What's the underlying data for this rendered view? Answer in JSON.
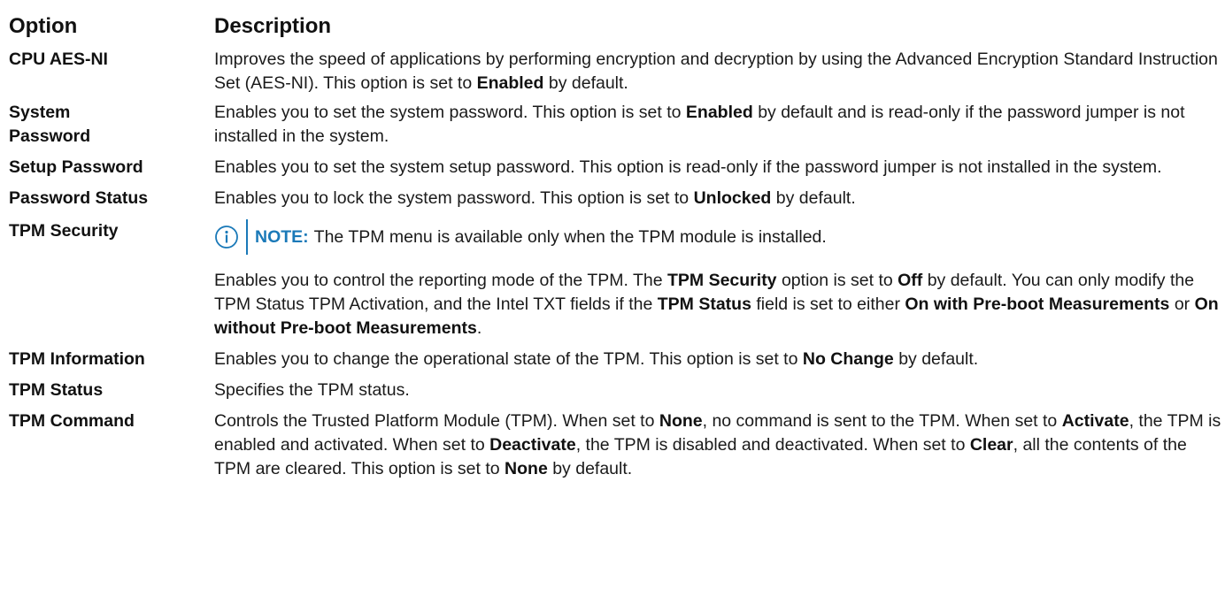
{
  "header": {
    "option": "Option",
    "description": "Description"
  },
  "rows": [
    {
      "option": "CPU AES-NI",
      "desc": [
        "Improves the speed of applications by performing encryption and decryption by using the Advanced Encryption Standard Instruction Set (AES-NI). This option is set to ",
        "Enabled",
        " by default."
      ]
    },
    {
      "option": "System Password",
      "desc": [
        "Enables you to set the system password. This option is set to ",
        "Enabled",
        " by default and is read-only if the password jumper is not installed in the system."
      ]
    },
    {
      "option": "Setup Password",
      "desc": [
        "Enables you to set the system setup password. This option is read-only if the password jumper is not installed in the system."
      ]
    },
    {
      "option": "Password Status",
      "desc": [
        "Enables you to lock the system password. This option is set to ",
        "Unlocked",
        " by default."
      ]
    },
    {
      "option": "TPM Security",
      "note": {
        "label": "NOTE:",
        "text": "The TPM menu is available only when the TPM module is installed.",
        "icon": "info-icon"
      },
      "desc": [
        "Enables you to control the reporting mode of the TPM. The ",
        "TPM Security",
        " option is set to ",
        "Off",
        " by default. You can only modify the TPM Status TPM Activation, and the Intel TXT fields if the ",
        "TPM Status",
        " field is set to either ",
        "On with Pre-boot Measurements",
        " or ",
        "On without Pre-boot Measurements",
        "."
      ]
    },
    {
      "option": "TPM Information",
      "desc": [
        "Enables you to change the operational state of the TPM. This option is set to ",
        "No Change",
        " by default."
      ]
    },
    {
      "option": "TPM Status",
      "desc": [
        "Specifies the TPM status."
      ]
    },
    {
      "option": "TPM Command",
      "desc": [
        "Controls the Trusted Platform Module (TPM). When set to ",
        "None",
        ", no command is sent to the TPM. When set to ",
        "Activate",
        ", the TPM is enabled and activated. When set to ",
        "Deactivate",
        ", the TPM is disabled and deactivated. When set to ",
        "Clear",
        ", all the contents of the TPM are cleared. This option is set to ",
        "None",
        " by default."
      ]
    }
  ],
  "colors": {
    "text": "#1a1a1a",
    "note_accent": "#1a79b8"
  }
}
